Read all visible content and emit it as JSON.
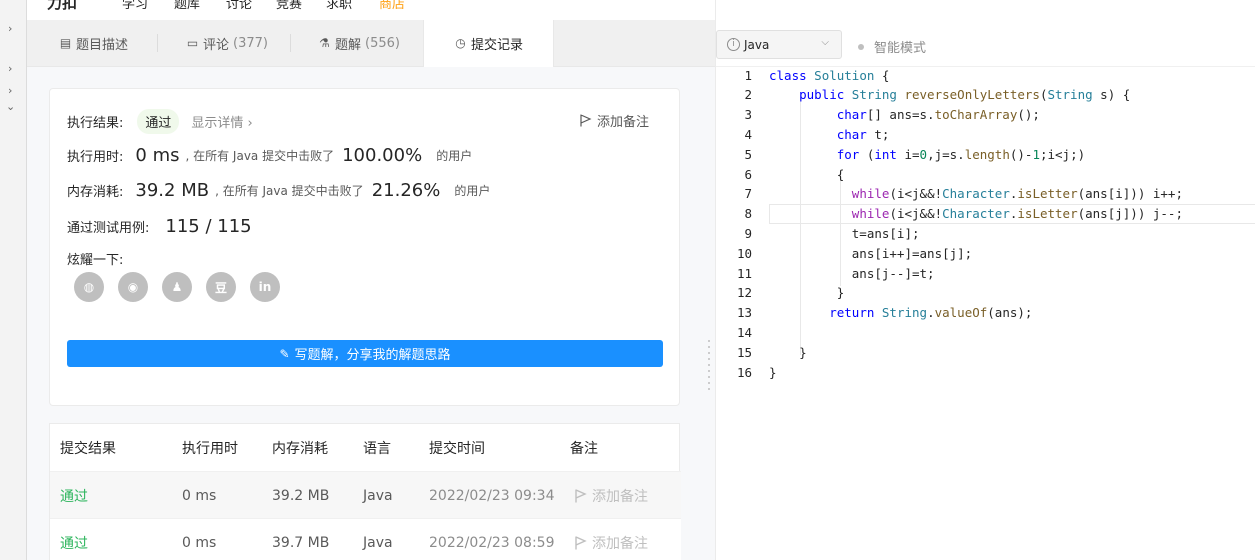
{
  "topnav": {
    "logo": "力扣",
    "items": [
      "学习",
      "题库",
      "讨论",
      "竞赛",
      "求职"
    ],
    "promo": "商店"
  },
  "tabs": [
    {
      "label": "题目描述",
      "count": "",
      "icon": "description-icon"
    },
    {
      "label": "评论",
      "count": "(377)",
      "icon": "comment-icon"
    },
    {
      "label": "题解",
      "count": "(556)",
      "icon": "flask-icon"
    },
    {
      "label": "提交记录",
      "count": "",
      "icon": "clock-icon"
    }
  ],
  "result": {
    "status_label": "执行结果:",
    "status_value": "通过",
    "detail_link": "显示详情 ›",
    "add_note": "添加备注",
    "runtime_label": "执行用时:",
    "runtime_value": "0 ms",
    "runtime_text": ", 在所有 Java 提交中击败了",
    "runtime_pct": "100.00%",
    "runtime_suffix": "的用户",
    "memory_label": "内存消耗:",
    "memory_value": "39.2 MB",
    "memory_text": ", 在所有 Java 提交中击败了",
    "memory_pct": "21.26%",
    "memory_suffix": "的用户",
    "cases_label": "通过测试用例:",
    "cases_value": "115 / 115",
    "share_label": "炫耀一下:",
    "share_icons": [
      "wechat-icon",
      "weibo-icon",
      "qq-icon",
      "douban-icon",
      "linkedin-icon"
    ],
    "share_glyphs": [
      "◍",
      "◉",
      "♟",
      "豆",
      "in"
    ],
    "write_button": "写题解，分享我的解题思路"
  },
  "submissions": {
    "headers": [
      "提交结果",
      "执行用时",
      "内存消耗",
      "语言",
      "提交时间",
      "备注"
    ],
    "rows": [
      {
        "status": "通过",
        "runtime": "0 ms",
        "memory": "39.2 MB",
        "lang": "Java",
        "time": "2022/02/23 09:34",
        "note": "添加备注"
      },
      {
        "status": "通过",
        "runtime": "0 ms",
        "memory": "39.7 MB",
        "lang": "Java",
        "time": "2022/02/23 08:59",
        "note": "添加备注"
      }
    ]
  },
  "editor": {
    "language": "Java",
    "smart_mode": "智能模式",
    "lines": [
      "class Solution {",
      "    public String reverseOnlyLetters(String s) {",
      "         char[] ans=s.toCharArray();",
      "         char t;",
      "         for (int i=0,j=s.length()-1;i<j;)",
      "         {",
      "           while(i<j&&!Character.isLetter(ans[i])) i++;",
      "           while(i<j&&!Character.isLetter(ans[j])) j--;",
      "           t=ans[i];",
      "           ans[i++]=ans[j];",
      "           ans[j--]=t;",
      "         }",
      "        return String.valueOf(ans);",
      "",
      "    }",
      "}"
    ]
  }
}
